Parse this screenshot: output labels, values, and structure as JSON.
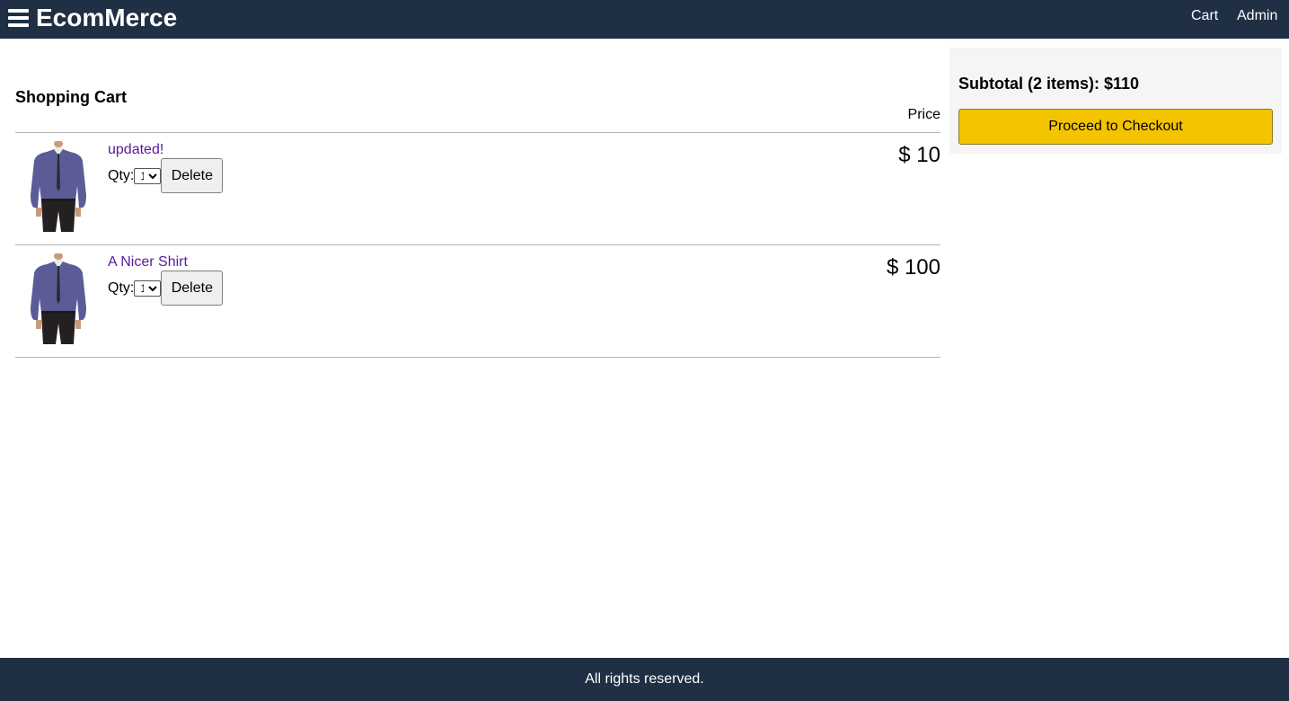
{
  "header": {
    "brand": "EcomMerce",
    "nav": {
      "cart": "Cart",
      "admin": "Admin"
    },
    "menu_icon": "hamburger-menu-icon"
  },
  "cart": {
    "title": "Shopping Cart",
    "price_header": "Price",
    "items": [
      {
        "name": "updated!",
        "qty_label": "Qty:",
        "qty_value": "1",
        "delete_label": "Delete",
        "price": "$ 10"
      },
      {
        "name": "A Nicer Shirt",
        "qty_label": "Qty:",
        "qty_value": "1",
        "delete_label": "Delete",
        "price": "$ 100"
      }
    ]
  },
  "summary": {
    "subtotal": "Subtotal (2 items): $110",
    "checkout_label": "Proceed to Checkout"
  },
  "footer": {
    "text": "All rights reserved."
  },
  "colors": {
    "header_bg": "#1f2f44",
    "checkout_button": "#f5c400",
    "product_link": "#5a1a9c"
  }
}
